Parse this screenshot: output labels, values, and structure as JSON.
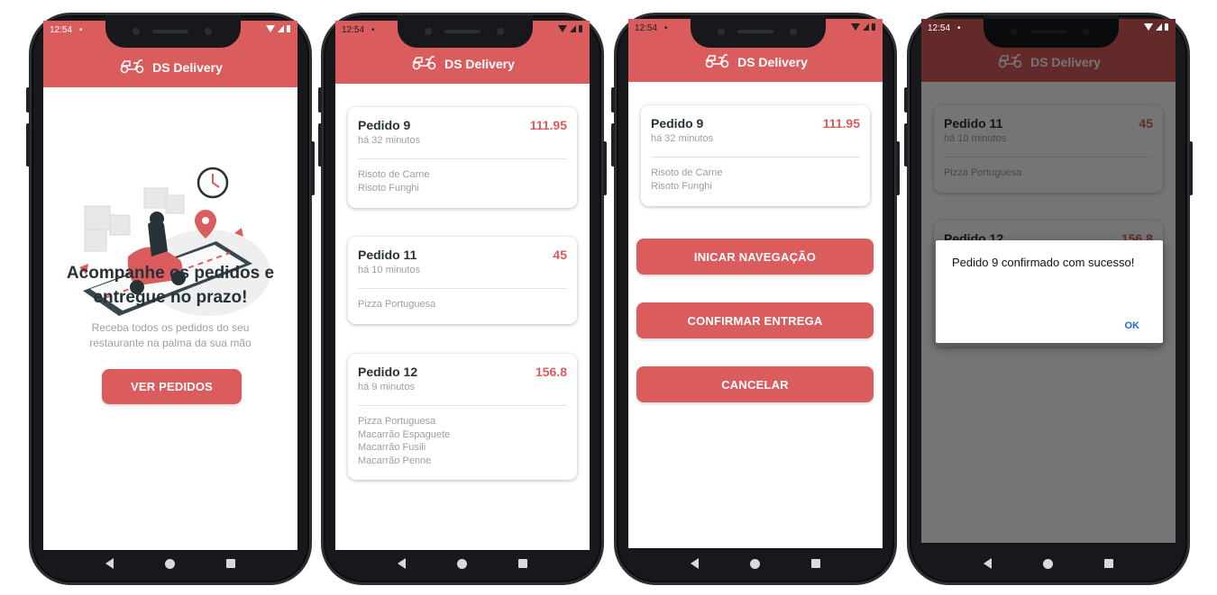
{
  "status": {
    "time": "12:54"
  },
  "app": {
    "title": "DS Delivery",
    "accent": "#da5c5c"
  },
  "home": {
    "title_line1": "Acompanhe os pedidos e",
    "title_line2": "entregue no prazo!",
    "subtitle_line1": "Receba todos os pedidos do seu",
    "subtitle_line2": "restaurante na palma da sua mão",
    "button": "VER PEDIDOS"
  },
  "orders": [
    {
      "title": "Pedido 9",
      "price": "111.95",
      "time": "há 32 minutos",
      "items": [
        "Risoto de Carne",
        "Risoto Funghi"
      ]
    },
    {
      "title": "Pedido 11",
      "price": "45",
      "time": "há 10 minutos",
      "items": [
        "Pizza Portuguesa"
      ]
    },
    {
      "title": "Pedido 12",
      "price": "156.8",
      "time": "há 9 minutos",
      "items": [
        "Pizza Portuguesa",
        "Macarrão Espaguete",
        "Macarrão Fusili",
        "Macarrão Penne"
      ]
    }
  ],
  "details": {
    "start_nav": "INICAR NAVEGAÇÃO",
    "confirm": "CONFIRMAR ENTREGA",
    "cancel": "CANCELAR"
  },
  "dialog": {
    "message": "Pedido 9 confirmado com sucesso!",
    "ok": "OK"
  },
  "icons": {
    "logo": "scooter-icon",
    "back": "back-triangle-icon",
    "home": "home-circle-icon",
    "recent": "recent-square-icon"
  }
}
